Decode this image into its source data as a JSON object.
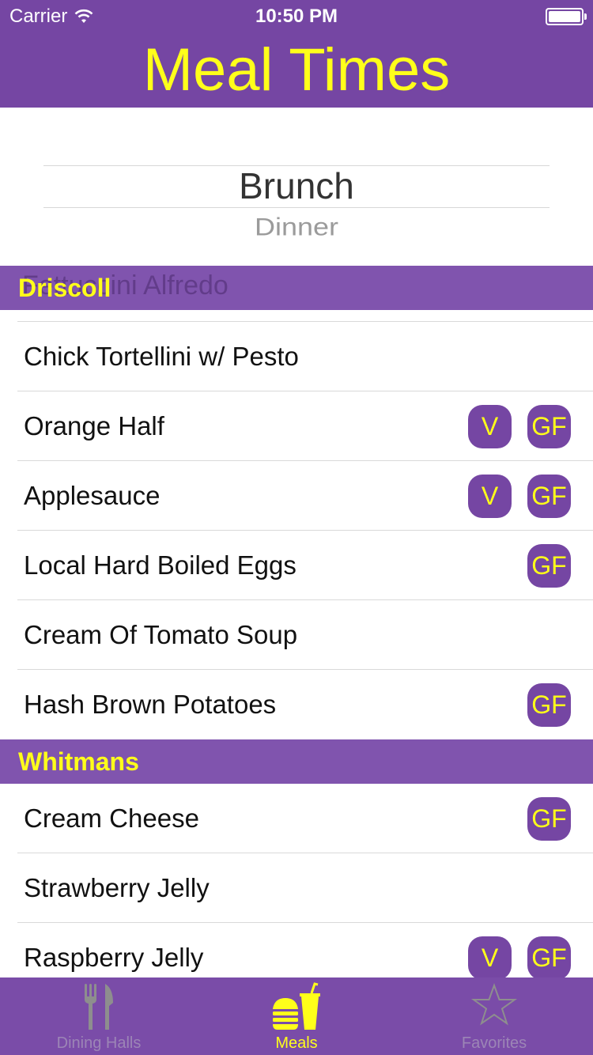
{
  "status_bar": {
    "carrier": "Carrier",
    "time": "10:50 PM"
  },
  "header": {
    "title": "Meal Times"
  },
  "picker": {
    "selected": "Brunch",
    "next": "Dinner"
  },
  "list": {
    "ghost_text": "Fettuccini Alfredo",
    "sections": [
      {
        "title": "Driscoll",
        "items": [
          {
            "name": "Chick Tortellini w/ Pesto",
            "v": false,
            "gf": false
          },
          {
            "name": "Orange Half",
            "v": true,
            "gf": true
          },
          {
            "name": "Applesauce",
            "v": true,
            "gf": true
          },
          {
            "name": "Local Hard Boiled Eggs",
            "v": false,
            "gf": true
          },
          {
            "name": "Cream Of Tomato Soup",
            "v": false,
            "gf": false
          },
          {
            "name": "Hash Brown Potatoes",
            "v": false,
            "gf": true
          }
        ]
      },
      {
        "title": "Whitmans",
        "items": [
          {
            "name": "Cream Cheese",
            "v": false,
            "gf": true
          },
          {
            "name": "Strawberry Jelly",
            "v": false,
            "gf": false
          },
          {
            "name": "Raspberry Jelly",
            "v": true,
            "gf": true
          }
        ]
      }
    ],
    "badges": {
      "v": "V",
      "gf": "GF"
    }
  },
  "tabbar": {
    "tabs": [
      {
        "label": "Dining Halls",
        "icon": "fork-knife-icon",
        "active": false
      },
      {
        "label": "Meals",
        "icon": "burger-drink-icon",
        "active": true
      },
      {
        "label": "Favorites",
        "icon": "star-icon",
        "active": false
      }
    ]
  },
  "colors": {
    "brand_purple": "#7546A3",
    "section_purple": "#8054AE",
    "accent_yellow": "#FFFF1A"
  }
}
